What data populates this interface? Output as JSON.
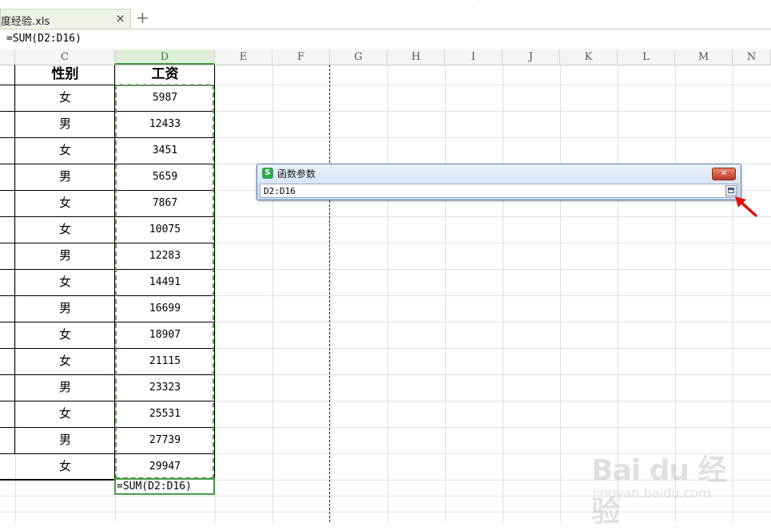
{
  "tab": {
    "title": "度经验.xls",
    "close": "×",
    "new": "+"
  },
  "formula_bar": {
    "text": "=SUM(D2:D16)"
  },
  "columns": [
    "C",
    "D",
    "E",
    "F",
    "G",
    "H",
    "I",
    "J",
    "K",
    "L",
    "M",
    "N"
  ],
  "table": {
    "headers": {
      "gender": "性别",
      "salary": "工资"
    },
    "rows": [
      {
        "gender": "女",
        "salary": "5987"
      },
      {
        "gender": "男",
        "salary": "12433"
      },
      {
        "gender": "女",
        "salary": "3451"
      },
      {
        "gender": "男",
        "salary": "5659"
      },
      {
        "gender": "女",
        "salary": "7867"
      },
      {
        "gender": "女",
        "salary": "10075"
      },
      {
        "gender": "男",
        "salary": "12283"
      },
      {
        "gender": "女",
        "salary": "14491"
      },
      {
        "gender": "男",
        "salary": "16699"
      },
      {
        "gender": "女",
        "salary": "18907"
      },
      {
        "gender": "女",
        "salary": "21115"
      },
      {
        "gender": "男",
        "salary": "23323"
      },
      {
        "gender": "女",
        "salary": "25531"
      },
      {
        "gender": "男",
        "salary": "27739"
      },
      {
        "gender": "女",
        "salary": "29947"
      }
    ],
    "sum_formula": "=SUM(D2:D16)"
  },
  "dialog": {
    "app_icon": "S",
    "title": "函数参数",
    "close": "✕",
    "reference": "D2:D16"
  },
  "watermark": {
    "logo": "Bai du 经验",
    "url": "jingyan.baidu.com"
  },
  "colors": {
    "accent": "#3e9a3e",
    "dialog_bar": "#c9daf0",
    "arrow": "#e01010"
  }
}
